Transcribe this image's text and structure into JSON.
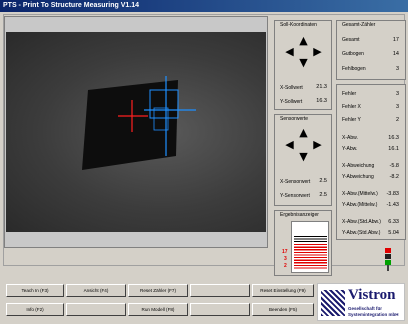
{
  "window": {
    "title": "PTS - Print To Structure Measuring V1.14"
  },
  "soll": {
    "title": "Soll-Koordinaten",
    "x_label": "X-Sollwert",
    "x_value": "21.3",
    "y_label": "Y-Sollwert",
    "y_value": "16.3"
  },
  "sensor": {
    "title": "Sensorwerte",
    "x_label": "X-Sensorwert",
    "x_value": "2.5",
    "y_label": "Y-Sensorwert",
    "y_value": "2.5"
  },
  "error_display": {
    "title": "Ergebnisanzeiger",
    "numbers": [
      "17",
      "3",
      "2"
    ]
  },
  "gesamt": {
    "title": "Gesamt-Zähler",
    "rows": [
      {
        "label": "Gesamt",
        "value": "17"
      },
      {
        "label": "Gutbogen",
        "value": "14"
      },
      {
        "label": "Fehlbogen",
        "value": "3"
      }
    ]
  },
  "stats": {
    "rows": [
      {
        "label": "Fehler",
        "value": "3"
      },
      {
        "label": "Fehler X",
        "value": "3"
      },
      {
        "label": "Fehler Y",
        "value": "2"
      },
      {
        "label": "X-Abw.",
        "value": "16.3"
      },
      {
        "label": "Y-Abw.",
        "value": "16.1"
      },
      {
        "label": "X-Abweichung",
        "value": "-5.8"
      },
      {
        "label": "Y-Abweichung",
        "value": "-8.2"
      },
      {
        "label": "X-Abw.(Mittelw.)",
        "value": "-3.83"
      },
      {
        "label": "Y-Abw.(Mittelw.)",
        "value": "-1.43"
      },
      {
        "label": "X-Abw.(Std.Abw.)",
        "value": "6.33"
      },
      {
        "label": "Y-Abw.(Std.Abw.)",
        "value": "5.04"
      }
    ]
  },
  "buttons": {
    "teach_in": "Teach In (F3)",
    "ansicht": "Ansicht (F4)",
    "reset_zaehler": "Reset Zähler (F7)",
    "disabled_1": "",
    "reset_einstellung": "Reset Einstellung (F9)",
    "info": "Info (F2)",
    "disabled_2": "",
    "run_modell": "Run Modell (F8)",
    "disabled_3": "",
    "beenden": "Beenden (F5)"
  },
  "logo": {
    "brand": "Vistron",
    "line1": "Gesellschaft für",
    "line2": "Systemintegration mbH"
  },
  "colors": {
    "titlebar": "#0a246a",
    "red_crosshair": "#ff2020",
    "blue_crosshair": "#1e8fff",
    "signal_red": "#e00000"
  }
}
